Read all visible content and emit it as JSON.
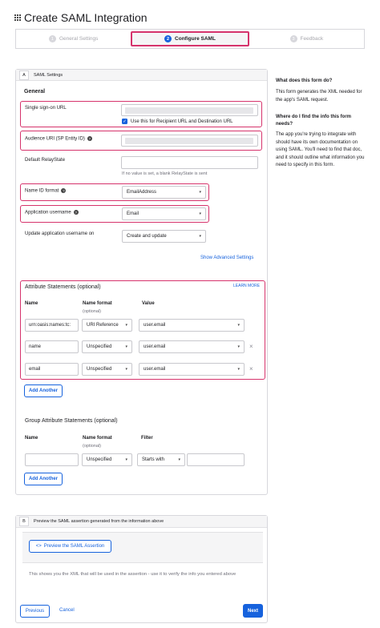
{
  "page": {
    "title": "Create SAML Integration"
  },
  "steps": [
    {
      "num": "1",
      "label": "General Settings"
    },
    {
      "num": "2",
      "label": "Configure SAML"
    },
    {
      "num": "3",
      "label": "Feedback"
    }
  ],
  "section_a": {
    "letter": "A",
    "title": "SAML Settings",
    "general_heading": "General",
    "sso_url_label": "Single sign-on URL",
    "sso_checkbox_label": "Use this for Recipient URL and Destination URL",
    "audience_label": "Audience URI (SP Entity ID)",
    "relaystate_label": "Default RelayState",
    "relaystate_hint": "If no value is set, a blank RelayState is sent",
    "nameid_label": "Name ID format",
    "nameid_value": "EmailAddress",
    "username_label": "Application username",
    "username_value": "Email",
    "update_label": "Update application username on",
    "update_value": "Create and update",
    "advanced_link": "Show Advanced Settings"
  },
  "attributes": {
    "title": "Attribute Statements (optional)",
    "learn_more": "LEARN MORE",
    "col_name": "Name",
    "col_format": "Name format",
    "col_format_sub": "(optional)",
    "col_value": "Value",
    "rows": [
      {
        "name": "urn:oasis:names:tc:",
        "format": "URI Reference",
        "value": "user.email"
      },
      {
        "name": "name",
        "format": "Unspecified",
        "value": "user.email"
      },
      {
        "name": "email",
        "format": "Unspecified",
        "value": "user.email"
      }
    ],
    "add_another": "Add Another"
  },
  "group_attributes": {
    "title": "Group Attribute Statements (optional)",
    "col_name": "Name",
    "col_format": "Name format",
    "col_format_sub": "(optional)",
    "col_filter": "Filter",
    "format_value": "Unspecified",
    "filter_value": "Starts with",
    "add_another": "Add Another"
  },
  "section_b": {
    "letter": "B",
    "title": "Preview the SAML assertion generated from the information above",
    "preview_button": "Preview the SAML Assertion",
    "preview_icon": "<>",
    "description": "This shows you the XML that will be used in the assertion - use it to verify the info you entered above"
  },
  "footer": {
    "previous": "Previous",
    "cancel": "Cancel",
    "next": "Next"
  },
  "help": {
    "q1": "What does this form do?",
    "a1": "This form generates the XML needed for the app's SAML request.",
    "q2": "Where do I find the info this form needs?",
    "a2": "The app you're trying to integrate with should have its own documentation on using SAML. You'll need to find that doc, and it should outline what information you need to specify in this form."
  },
  "colors": {
    "accent": "#1662dd",
    "highlight": "#d6336c",
    "border": "#d7d7dc"
  }
}
